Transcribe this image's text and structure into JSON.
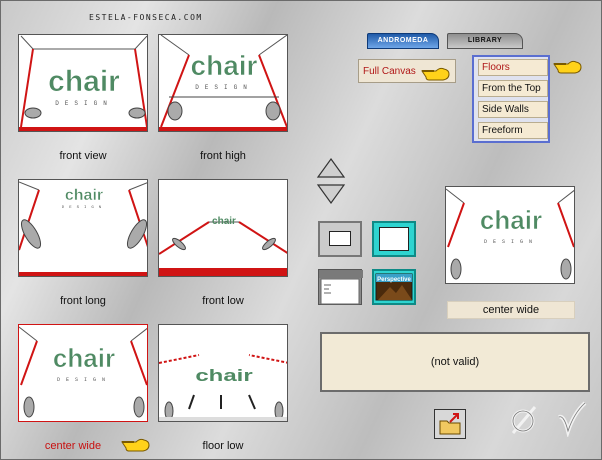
{
  "brand": "ESTELA-FONSECA.COM",
  "logo_text": "chair",
  "logo_sub": "DESIGN",
  "views": [
    {
      "caption": "front view"
    },
    {
      "caption": "front high"
    },
    {
      "caption": "front long"
    },
    {
      "caption": "front low"
    },
    {
      "caption": "center wide"
    },
    {
      "caption": "floor low"
    }
  ],
  "tabs": {
    "andromeda": "ANDROMEDA",
    "library": "LIBRARY"
  },
  "full_canvas": "Full Canvas",
  "menu": {
    "items": [
      "Floors",
      "From the Top",
      "Side Walls",
      "Freeform"
    ]
  },
  "perspective_label": "Perspective",
  "preview_label": "center wide",
  "status_text": "(not valid)",
  "colors": {
    "accent_red": "#c81010",
    "menu_border": "#5a6ed0",
    "logo_green": "#4f8a63"
  }
}
